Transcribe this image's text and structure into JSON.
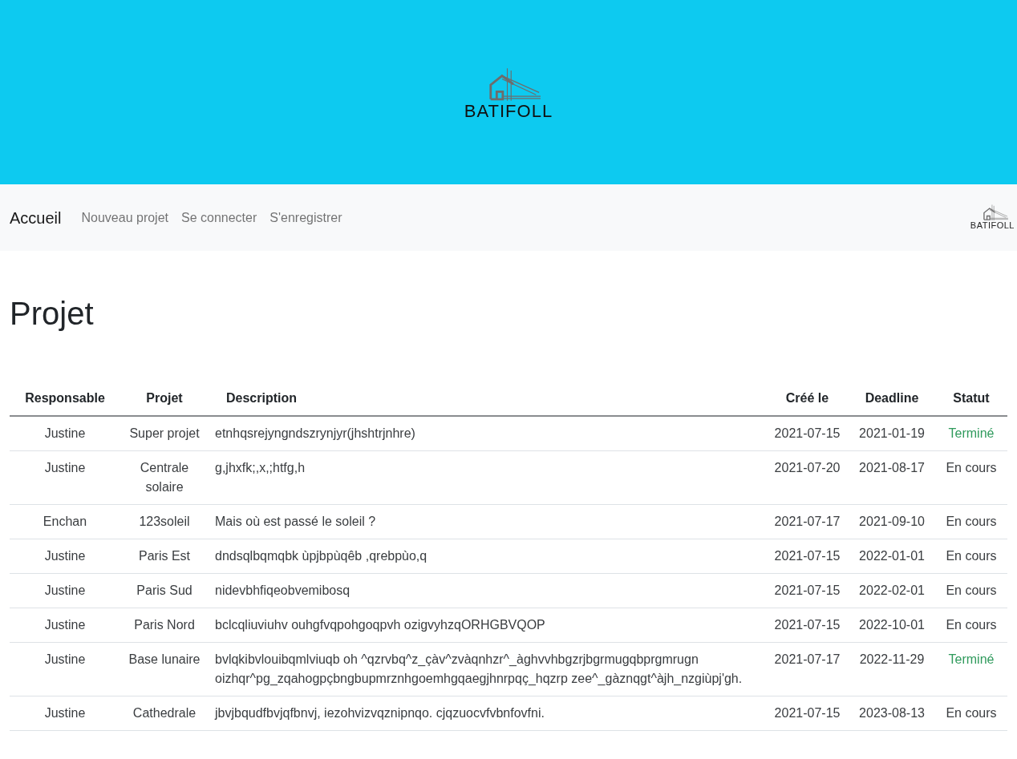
{
  "header": {
    "logo_text": "BATIFOLL"
  },
  "navbar": {
    "brand": "Accueil",
    "links": [
      "Nouveau projet",
      "Se connecter",
      "S'enregistrer"
    ],
    "logo_text": "BATIFOLL"
  },
  "page": {
    "title": "Projet"
  },
  "table": {
    "columns": [
      "Responsable",
      "Projet",
      "Description",
      "Créé le",
      "Deadline",
      "Statut"
    ],
    "rows": [
      {
        "responsable": "Justine",
        "projet": "Super projet",
        "description": "etnhqsrejyngndszrynjyr(jhshtrjnhre)",
        "created": "2021-07-15",
        "deadline": "2021-01-19",
        "status": "Terminé",
        "finished": true
      },
      {
        "responsable": "Justine",
        "projet": "Centrale solaire",
        "description": "g,jhxfk;,x,;htfg,h",
        "created": "2021-07-20",
        "deadline": "2021-08-17",
        "status": "En cours",
        "finished": false
      },
      {
        "responsable": "Enchan",
        "projet": "123soleil",
        "description": "Mais où est passé le soleil ?",
        "created": "2021-07-17",
        "deadline": "2021-09-10",
        "status": "En cours",
        "finished": false
      },
      {
        "responsable": "Justine",
        "projet": "Paris Est",
        "description": "dndsqlbqmqbk ùpjbpùqêb ,qrebpùo,q",
        "created": "2021-07-15",
        "deadline": "2022-01-01",
        "status": "En cours",
        "finished": false
      },
      {
        "responsable": "Justine",
        "projet": "Paris Sud",
        "description": "nidevbhfiqeobvemibosq",
        "created": "2021-07-15",
        "deadline": "2022-02-01",
        "status": "En cours",
        "finished": false
      },
      {
        "responsable": "Justine",
        "projet": "Paris Nord",
        "description": "bclcqliuviuhv ouhgfvqpohgoqpvh ozigvyhzqORHGBVQOP",
        "created": "2021-07-15",
        "deadline": "2022-10-01",
        "status": "En cours",
        "finished": false
      },
      {
        "responsable": "Justine",
        "projet": "Base lunaire",
        "description": "bvlqkibvlouibqmlviuqb oh ^qzrvbq^z_çàv^zvàqnhzr^_àghvvhbgzrjbgrmugqbprgmrugn oizhqr^pg_zqahogpçbngbupmrznhgoemhgqaegjhnrpqç_hqzrp zee^_gàznqgt^àjh_nzgiùpj'gh.",
        "created": "2021-07-17",
        "deadline": "2022-11-29",
        "status": "Terminé",
        "finished": true
      },
      {
        "responsable": "Justine",
        "projet": "Cathedrale",
        "description": "jbvjbqudfbvjqfbnvj, iezohvizvqznipnqo. cjqzuocvfvbnfovfni.",
        "created": "2021-07-15",
        "deadline": "2023-08-13",
        "status": "En cours",
        "finished": false
      }
    ]
  }
}
